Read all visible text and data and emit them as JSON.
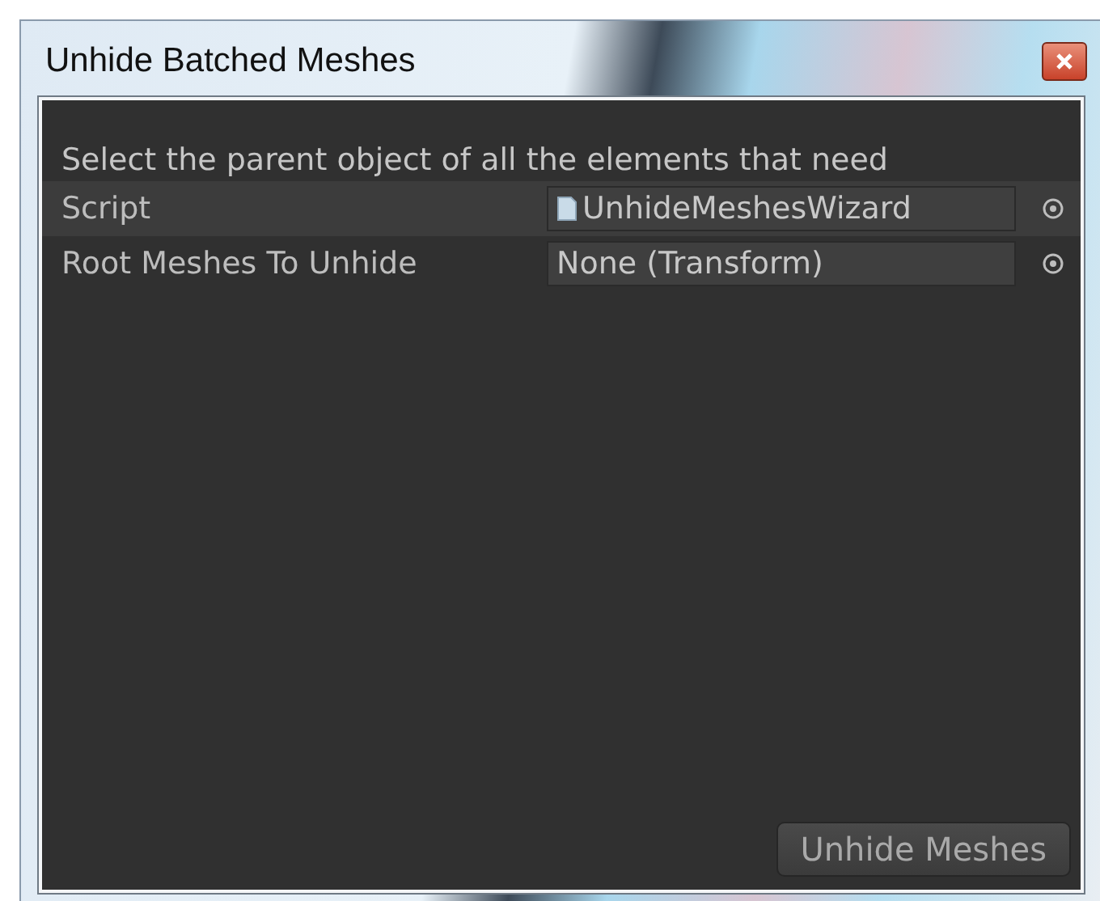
{
  "window": {
    "title": "Unhide Batched Meshes"
  },
  "help_text": "Select the parent object of all the elements that need",
  "fields": [
    {
      "label": "Script",
      "value": "UnhideMeshesWizard",
      "kind": "script"
    },
    {
      "label": "Root Meshes To Unhide",
      "value": "None (Transform)",
      "kind": "object"
    }
  ],
  "buttons": [
    "Unhide Meshes"
  ]
}
